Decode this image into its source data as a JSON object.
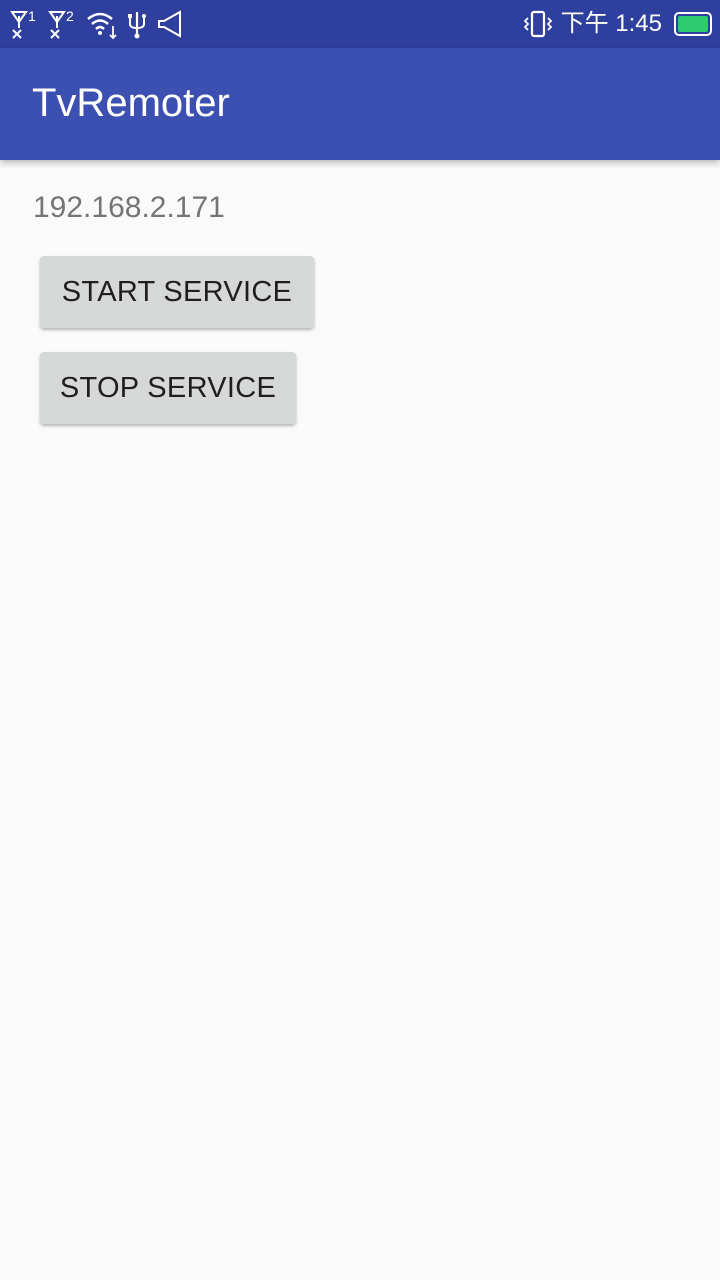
{
  "status_bar": {
    "sim1_label": "1",
    "sim2_label": "2",
    "time": "下午 1:45",
    "icons": [
      "signal-sim1-icon",
      "signal-sim2-icon",
      "wifi-icon",
      "usb-icon",
      "notification-icon",
      "vibrate-icon",
      "battery-icon"
    ],
    "battery_color": "#2ecc71"
  },
  "app_bar": {
    "title": "TvRemoter",
    "color": "#3c50b2"
  },
  "main": {
    "ip_address": "192.168.2.171",
    "start_button_label": "START SERVICE",
    "stop_button_label": "STOP SERVICE"
  }
}
